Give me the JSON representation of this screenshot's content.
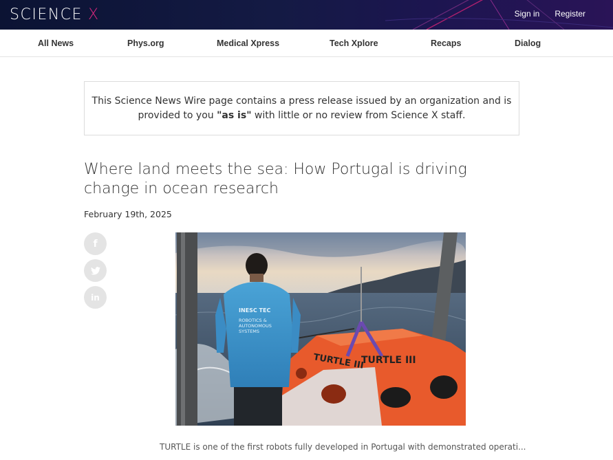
{
  "header": {
    "logo_text": "SCIENCE",
    "logo_mark": "X",
    "sign_in": "Sign in",
    "register": "Register",
    "accent_color": "#d8287d"
  },
  "nav": {
    "items": [
      {
        "label": "All News"
      },
      {
        "label": "Phys.org"
      },
      {
        "label": "Medical Xpress"
      },
      {
        "label": "Tech Xplore"
      },
      {
        "label": "Recaps"
      },
      {
        "label": "Dialog"
      }
    ]
  },
  "notice": {
    "text_before": "This Science News Wire page contains a press release issued by an organization and is provided to you ",
    "emphasis": "\"as is\"",
    "text_after": " with little or no review from Science X staff."
  },
  "article": {
    "title": "Where land meets the sea: How Portugal is driving change in ocean research",
    "date": "February 19th, 2025",
    "share": [
      {
        "icon": "facebook-icon",
        "glyph": "f"
      },
      {
        "icon": "twitter-icon",
        "glyph": ""
      },
      {
        "icon": "linkedin-icon",
        "glyph": "in"
      }
    ],
    "image": {
      "shirt_text_1": "INESC TEC",
      "shirt_text_2": "ROBOTICS &",
      "shirt_text_3": "AUTONOMOUS",
      "shirt_text_4": "SYSTEMS",
      "robot_label_1": "TURTLE III",
      "robot_label_2": "TURTLE III"
    },
    "caption": "TURTLE is one of the first robots fully developed in Portugal with demonstrated operati..."
  }
}
